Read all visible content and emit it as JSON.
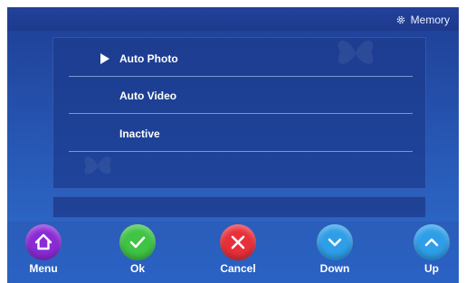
{
  "header": {
    "title": "Memory",
    "title_icon": "gear-icon"
  },
  "menu": {
    "selected_index": 0,
    "items": [
      {
        "label": "Auto Photo"
      },
      {
        "label": "Auto Video"
      },
      {
        "label": "Inactive"
      }
    ]
  },
  "softkeys": [
    {
      "label": "Menu",
      "icon": "home-icon",
      "color": "#8a2bd6"
    },
    {
      "label": "Ok",
      "icon": "check-icon",
      "color": "#3fc444"
    },
    {
      "label": "Cancel",
      "icon": "close-icon",
      "color": "#e8303a"
    },
    {
      "label": "Down",
      "icon": "chevron-down-icon",
      "color": "#2f9ee8"
    },
    {
      "label": "Up",
      "icon": "chevron-up-icon",
      "color": "#2f9ee8"
    }
  ]
}
